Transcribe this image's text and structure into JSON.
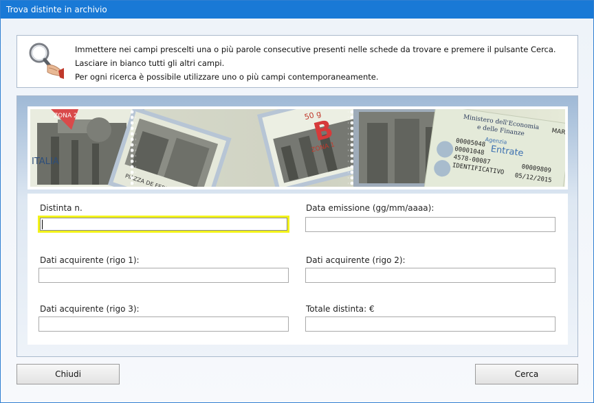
{
  "window": {
    "title": "Trova distinte in archivio"
  },
  "info": {
    "lines": [
      "Immettere nei campi prescelti una o più parole consecutive presenti nelle schede da trovare e premere il pulsante Cerca.",
      "Lasciare in bianco tutti gli altri campi.",
      "Per ogni ricerca è possibile utilizzare uno o più campi contemporaneamente."
    ],
    "icon": "magnifier-hand-icon"
  },
  "banner": {
    "stamp1_text": "ZONA 2",
    "stamp2_text": "PIAZZA DE FERRARI - GENOVA",
    "stamp3_value": "50 g",
    "stamp3_letter": "B",
    "stamp3_zone": "ZONA 1",
    "stamp_country": "ITALIA",
    "doc_line1": "Ministero dell'Economia",
    "doc_line2": "e delle Finanze",
    "doc_agency": "Agenzia",
    "doc_entrate": "Entrate",
    "doc_serial1": "00005048",
    "doc_serial2": "00001048",
    "doc_serial3": "4578-00087",
    "doc_ident": "IDENTIFICATIVO",
    "doc_date": "05/12/2015",
    "doc_code": "00009809",
    "doc_mar": "MAR"
  },
  "fields": {
    "distinta": {
      "label": "Distinta n.",
      "value": ""
    },
    "data_emissione": {
      "label": "Data emissione (gg/mm/aaaa):",
      "value": ""
    },
    "acquirente1": {
      "label": "Dati acquirente (rigo 1):",
      "value": ""
    },
    "acquirente2": {
      "label": "Dati acquirente (rigo 2):",
      "value": ""
    },
    "acquirente3": {
      "label": "Dati acquirente (rigo 3):",
      "value": ""
    },
    "totale": {
      "label": "Totale distinta: €",
      "value": ""
    }
  },
  "buttons": {
    "close_label": "Chiudi",
    "search_label": "Cerca"
  }
}
